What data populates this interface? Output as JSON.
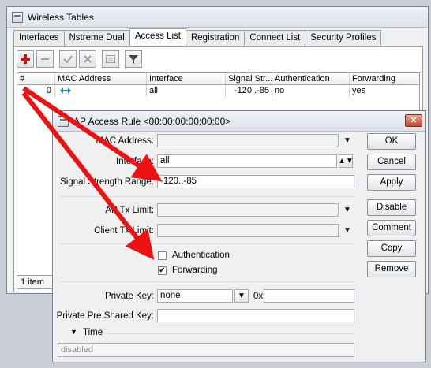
{
  "main_window": {
    "title": "Wireless Tables",
    "tabs": [
      {
        "label": "Interfaces",
        "active": false
      },
      {
        "label": "Nstreme Dual",
        "active": false
      },
      {
        "label": "Access List",
        "active": true
      },
      {
        "label": "Registration",
        "active": false
      },
      {
        "label": "Connect List",
        "active": false
      },
      {
        "label": "Security Profiles",
        "active": false
      }
    ],
    "toolbar": {
      "add_icon": "plus-icon",
      "remove_icon": "minus-icon",
      "enable_icon": "check-icon",
      "disable_icon": "cross-icon",
      "comment_icon": "comment-icon",
      "filter_icon": "filter-icon",
      "add_color": "#cc1111"
    },
    "table": {
      "columns": [
        "#",
        "MAC Address",
        "Interface",
        "Signal Str...",
        "Authentication",
        "Forwarding"
      ],
      "rows": [
        {
          "index": "0",
          "mac_icon": "mac-address-icon",
          "mac": "",
          "interface": "all",
          "signal": "-120..-85",
          "authentication": "no",
          "forwarding": "yes"
        }
      ]
    },
    "status": "1 item"
  },
  "dialog": {
    "title": "AP Access Rule <00:00:00:00:00:00>",
    "fields": {
      "mac_address": {
        "label": "MAC Address:",
        "value": ""
      },
      "interface": {
        "label": "Interface:",
        "value": "all"
      },
      "signal_strength_range": {
        "label": "Signal Strength Range:",
        "value": "-120..-85"
      },
      "ap_tx_limit": {
        "label": "AP Tx Limit:",
        "value": ""
      },
      "client_tx_limit": {
        "label": "Client Tx Limit:",
        "value": ""
      },
      "authentication": {
        "label": "Authentication",
        "checked": false
      },
      "forwarding": {
        "label": "Forwarding",
        "checked": true
      },
      "private_key": {
        "label": "Private Key:",
        "value": "none",
        "hex_prefix": "0x",
        "hex_value": ""
      },
      "private_pre_shared_key": {
        "label": "Private Pre Shared Key:",
        "value": ""
      },
      "time_section": {
        "label": "Time"
      }
    },
    "buttons": {
      "ok": "OK",
      "cancel": "Cancel",
      "apply": "Apply",
      "disable": "Disable",
      "comment": "Comment",
      "copy": "Copy",
      "remove": "Remove"
    },
    "status": "disabled"
  },
  "annotations": {
    "arrow_color": "#ee1111"
  }
}
